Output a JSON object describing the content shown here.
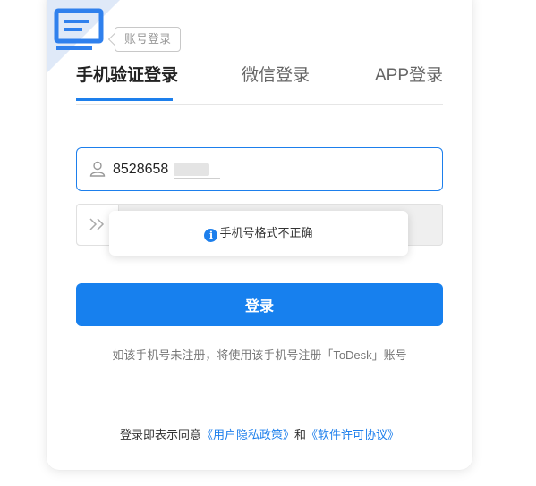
{
  "colors": {
    "accent": "#1d7fec",
    "button": "#1780ee",
    "corner": "#dfe9f8"
  },
  "corner": {
    "icon": "document-lines-icon",
    "account_login_tip": "账号登录"
  },
  "tabs": [
    {
      "label": "手机验证登录",
      "active": true
    },
    {
      "label": "微信登录",
      "active": false
    },
    {
      "label": "APP登录",
      "active": false
    }
  ],
  "phone": {
    "icon": "user-icon",
    "value": "8528658"
  },
  "slider": {
    "icon": "double-chevron-right-icon"
  },
  "toast": {
    "icon": "info-icon",
    "icon_glyph": "i",
    "message": "手机号格式不正确"
  },
  "login_button": "登录",
  "hint": "如该手机号未注册，将使用该手机号注册「ToDesk」账号",
  "agreement": {
    "prefix": "登录即表示同意",
    "privacy": "《用户隐私政策》",
    "and": "和",
    "license": "《软件许可协议》"
  }
}
